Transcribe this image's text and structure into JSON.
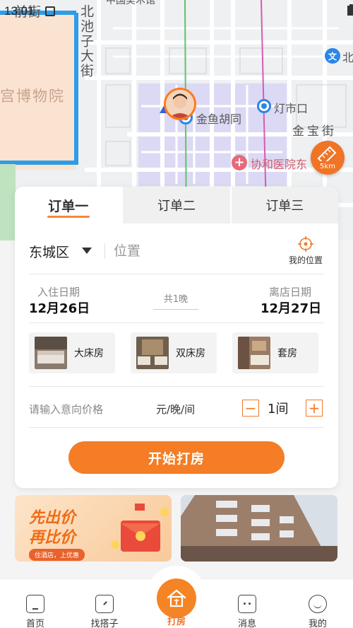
{
  "status_bar": {
    "time": "13:01"
  },
  "map": {
    "labels": {
      "street_top": "前街",
      "street_vertical": "北池子大街",
      "museum": "宫博物院",
      "metro_a": "金鱼胡同",
      "metro_b": "灯市口",
      "street_right": "金宝街",
      "hospital": "协和医院东",
      "road_top": "中国美术馆",
      "poi_right": "北"
    },
    "poi_icon_label": "文",
    "hospital_icon": "+",
    "range_label": "5km"
  },
  "order_card": {
    "tabs": [
      {
        "label": "订单一",
        "active": true
      },
      {
        "label": "订单二",
        "active": false
      },
      {
        "label": "订单三",
        "active": false
      }
    ],
    "district": "东城区",
    "location_placeholder": "位置",
    "my_location_label": "我的位置",
    "checkin_label": "入住日期",
    "checkin_date": "12月26日",
    "nights_label": "共1晚",
    "checkout_label": "离店日期",
    "checkout_date": "12月27日",
    "room_types": [
      {
        "label": "大床房"
      },
      {
        "label": "双床房"
      },
      {
        "label": "套房"
      }
    ],
    "price_placeholder": "请输入意向价格",
    "price_unit": "元/晚/间",
    "rooms_count": "1间",
    "stepper_minus": "−",
    "stepper_plus": "+",
    "start_button": "开始打房"
  },
  "banners": {
    "promo_line1": "先出价",
    "promo_line2": "再比价",
    "promo_tag": "住酒店，上优惠"
  },
  "bottom_nav": {
    "items": [
      {
        "label": "首页"
      },
      {
        "label": "找搭子"
      },
      {
        "label": "打房",
        "active": true
      },
      {
        "label": "消息"
      },
      {
        "label": "我的"
      }
    ]
  },
  "colors": {
    "accent": "#F47D25",
    "map_blue": "#2A86E8",
    "palace": "#FBE3D2"
  }
}
